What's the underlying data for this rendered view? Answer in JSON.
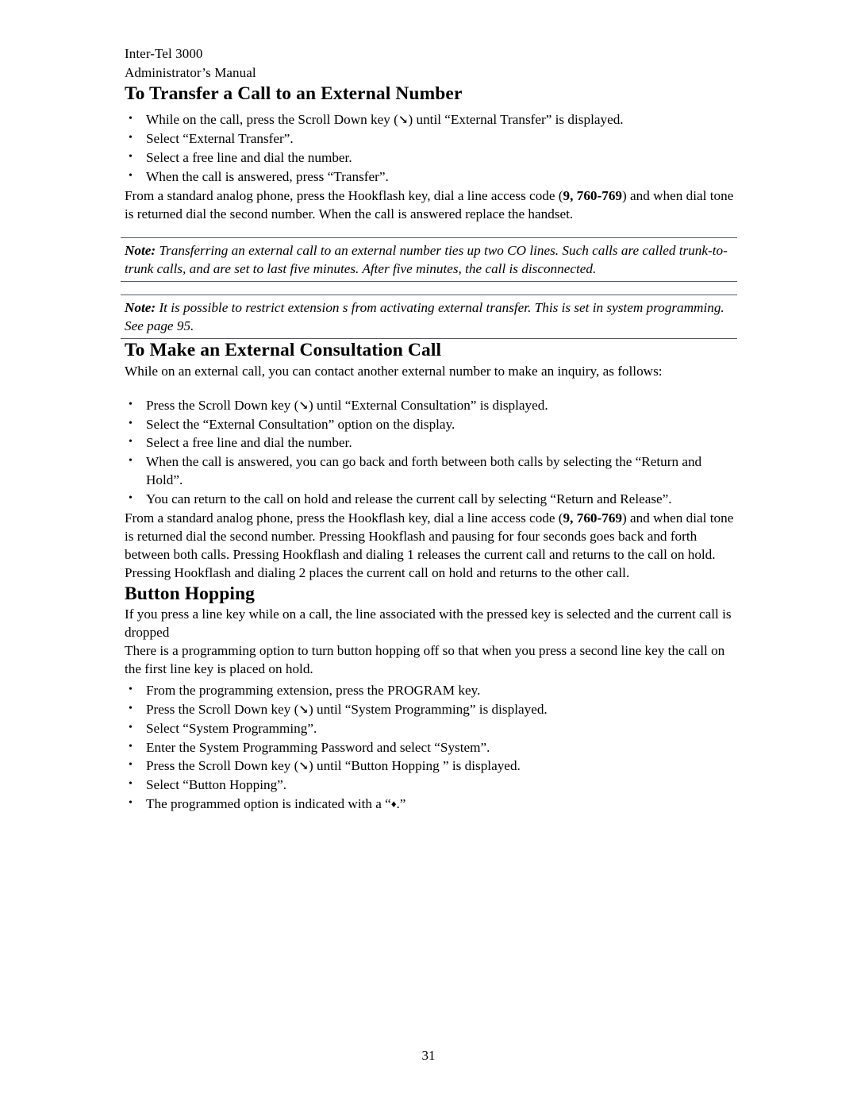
{
  "document": {
    "running_header": {
      "line1": "Inter-Tel 3000",
      "line2": "Administrator’s Manual"
    },
    "page_number": "31",
    "glyphs": {
      "bullet": "•",
      "scroll_down_arrow": "↘",
      "diamond": "♦"
    },
    "sections": [
      {
        "heading": "To Transfer a Call to an External Number",
        "bullets_1": [
          {
            "pre": "While on the call, press the Scroll Down key (",
            "arrow": true,
            "post": ") until “External Transfer” is displayed."
          },
          {
            "pre": "Select “External Transfer”.",
            "arrow": false,
            "post": ""
          },
          {
            "pre": "Select a free line and dial the number.",
            "arrow": false,
            "post": ""
          },
          {
            "pre": "When the call is answered, press “Transfer”.",
            "arrow": false,
            "post": ""
          }
        ],
        "paragraph": {
          "pre": "From a standard analog phone, press the Hookflash key, dial a line access code (",
          "bold": "9, 760-769",
          "post": ") and when dial tone is returned dial the second number. When the call is answered replace the handset."
        },
        "notes": [
          {
            "label": "Note:",
            "text": " Transferring an external call to an external number ties up two CO lines.  Such calls are called trunk-to-trunk calls, and are set to last five minutes. After five minutes, the call is disconnected."
          },
          {
            "label": "Note:",
            "text": " It is possible to restrict extension s from activating external transfer. This is set in system programming. See page 95."
          }
        ]
      },
      {
        "heading": "To Make an External Consultation Call",
        "intro": "While on an external call, you can contact another external number to make an inquiry, as follows:",
        "bullets_1": [
          {
            "pre": "Press the Scroll Down key (",
            "arrow": true,
            "post": ") until “External Consultation” is displayed."
          },
          {
            "pre": "Select the “External Consultation” option on the display.",
            "arrow": false,
            "post": ""
          },
          {
            "pre": "Select a free line and dial the number.",
            "arrow": false,
            "post": ""
          },
          {
            "pre": "When the call is answered, you can go back and forth between both calls by selecting the “Return and Hold”.",
            "arrow": false,
            "post": ""
          },
          {
            "pre": "You can return to the call on hold and release the current call by selecting “Return and Release”.",
            "arrow": false,
            "post": ""
          }
        ],
        "paragraph": {
          "pre": "From a standard analog phone, press the Hookflash key, dial a line access code (",
          "bold": "9, 760-769",
          "post": ") and when dial tone is returned dial the second number. Pressing Hookflash and pausing for four seconds goes back and forth between both calls. Pressing Hookflash and dialing 1 releases the current call and returns to the call on hold. Pressing Hookflash and dialing 2 places the current call on hold and returns to the other call."
        }
      },
      {
        "heading": "Button Hopping",
        "para1": "If you press a line key while on a call, the line associated with the pressed key is selected and the current call is dropped",
        "para2": "There is a programming option to turn button hopping off so that when you press a second line key the call on the first line key is placed on hold.",
        "bullets_1": [
          {
            "pre": "From the programming extension, press the PROGRAM key.",
            "arrow": false,
            "post": ""
          },
          {
            "pre": "Press the Scroll Down key (",
            "arrow": true,
            "post": ") until “System Programming” is displayed."
          },
          {
            "pre": "Select “System Programming”.",
            "arrow": false,
            "post": ""
          },
          {
            "pre": "Enter the System Programming Password and select “System”.",
            "arrow": false,
            "post": ""
          },
          {
            "pre": "Press the Scroll Down key (",
            "arrow": true,
            "post": ") until “Button Hopping ” is displayed."
          },
          {
            "pre": "Select “Button Hopping”.",
            "arrow": false,
            "post": ""
          },
          {
            "pre": "The programmed option is indicated with a “",
            "diamond": true,
            "post": ".”"
          }
        ]
      }
    ]
  }
}
